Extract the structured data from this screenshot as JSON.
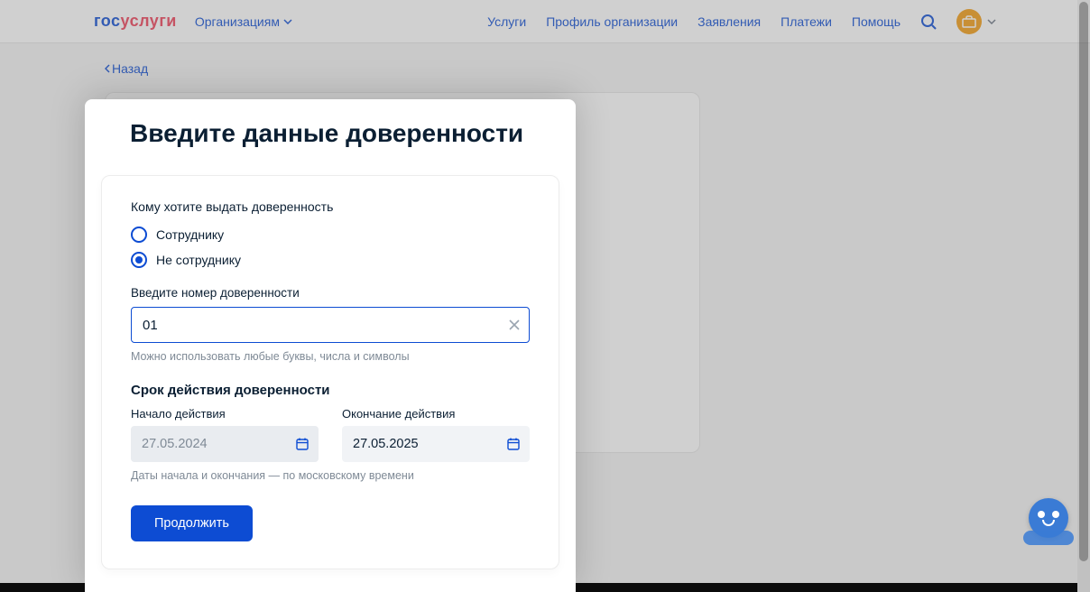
{
  "header": {
    "logo": {
      "part1": "гос",
      "part2": "услуги"
    },
    "org_selector": "Организациям",
    "nav": {
      "services": "Услуги",
      "profile": "Профиль организации",
      "applications": "Заявления",
      "payments": "Платежи",
      "help": "Помощь"
    }
  },
  "page": {
    "back": "Назад",
    "title": "Введите данные доверенности"
  },
  "form": {
    "who_label": "Кому хотите выдать доверенность",
    "radio_employee": "Сотруднику",
    "radio_non_employee": "Не сотруднику",
    "radio_selected": "non_employee",
    "number_label": "Введите номер доверенности",
    "number_value": "01",
    "number_hint": "Можно использовать любые буквы, числа и символы",
    "validity_heading": "Срок действия доверенности",
    "start_label": "Начало действия",
    "start_value": "27.05.2024",
    "end_label": "Окончание действия",
    "end_value": "27.05.2025",
    "dates_hint": "Даты начала и окончания — по московскому времени",
    "continue": "Продолжить"
  }
}
